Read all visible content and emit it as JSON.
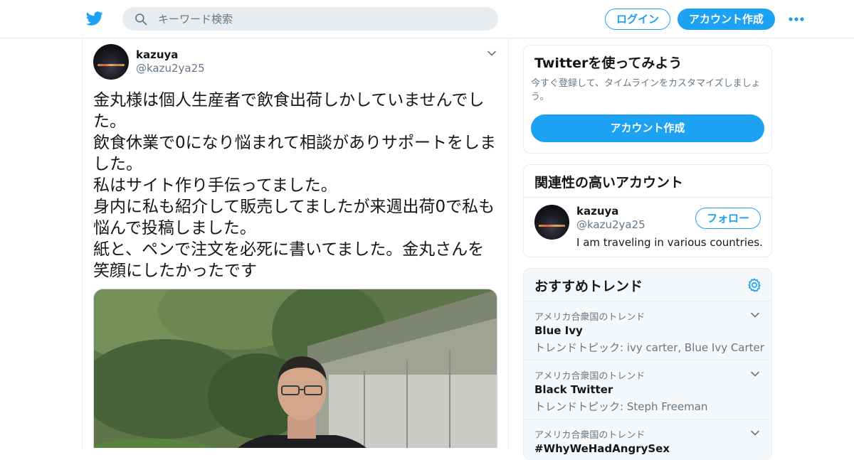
{
  "header": {
    "search_placeholder": "キーワード検索",
    "login_label": "ログイン",
    "signup_label": "アカウント作成"
  },
  "tweet": {
    "name": "kazuya",
    "handle": "@kazu2ya25",
    "text": "金丸様は個人生産者で飲食出荷しかしていませんでした。\n飲食休業で0になり悩まれて相談がありサポートをしました。\n私はサイト作り手伝ってました。\n身内に私も紹介して販売してましたが来週出荷0で私も悩んで投稿しました。\n紙と、ペンで注文を必死に書いてました。金丸さんを笑顔にしたかったです"
  },
  "signup_card": {
    "title": "Twitterを使ってみよう",
    "description": "今すぐ登録して、タイムラインをカスタマイズしましょう。",
    "button_label": "アカウント作成"
  },
  "related_card": {
    "title": "関連性の高いアカウント",
    "account": {
      "name": "kazuya",
      "handle": "@kazu2ya25",
      "bio": "I am traveling in various countries.",
      "follow_label": "フォロー"
    }
  },
  "trends_card": {
    "title": "おすすめトレンド",
    "items": [
      {
        "context": "アメリカ合衆国のトレンド",
        "name": "Blue Ivy",
        "topics": "トレンドトピック: ivy carter, Blue Ivy Carter"
      },
      {
        "context": "アメリカ合衆国のトレンド",
        "name": "Black Twitter",
        "topics": "トレンドトピック: Steph Freeman"
      },
      {
        "context": "アメリカ合衆国のトレンド",
        "name": "#WhyWeHadAngrySex",
        "topics": ""
      }
    ]
  },
  "colors": {
    "accent": "#1da1f2",
    "text_primary": "#14171a",
    "text_secondary": "#657786",
    "border": "#e6ecf0",
    "panel_bg": "#f5f8fa"
  },
  "icons": {
    "logo": "twitter-bird-icon",
    "search": "search-icon",
    "more": "more-dots-icon",
    "caret": "chevron-down-icon",
    "settings": "gear-icon"
  }
}
